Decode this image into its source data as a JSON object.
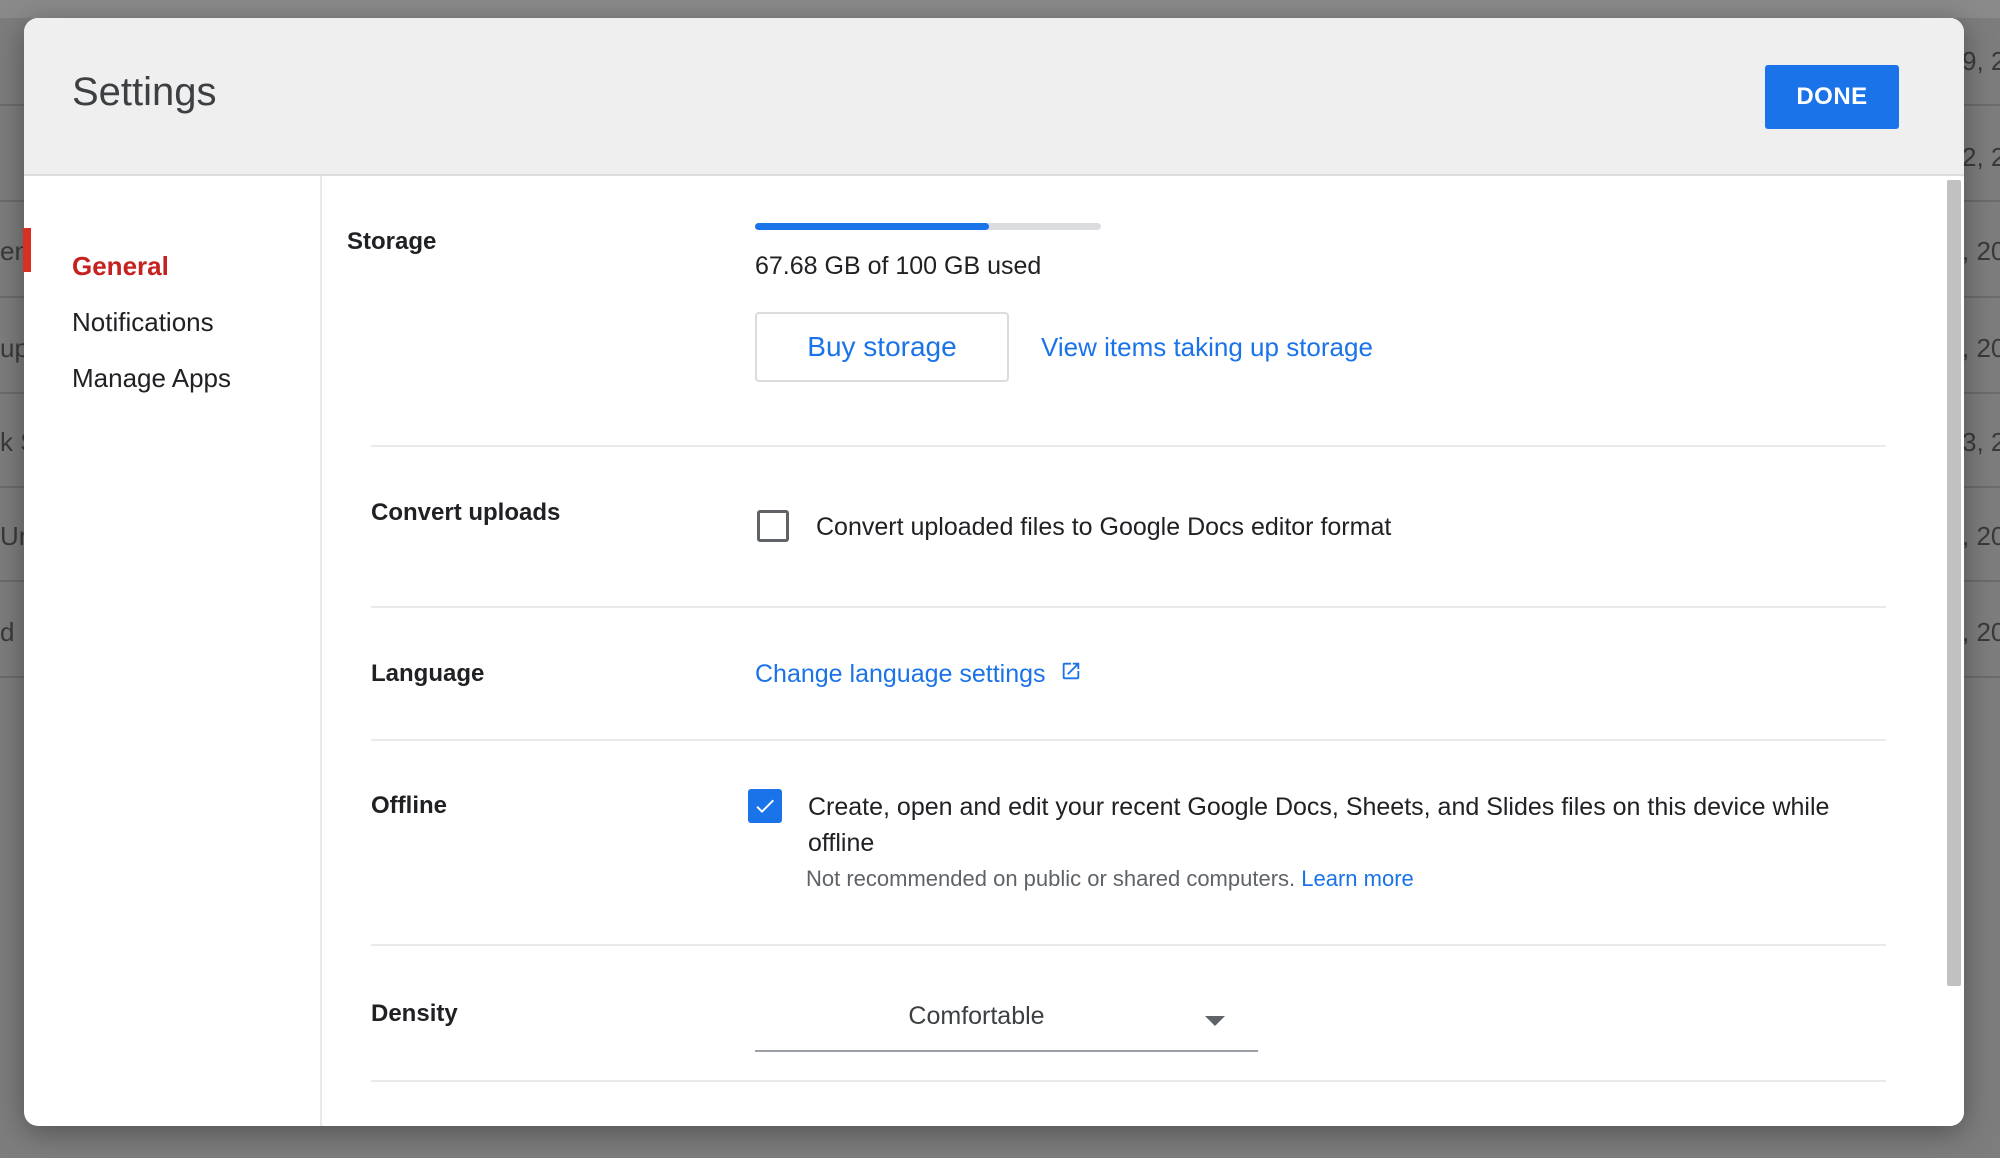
{
  "background": {
    "left_fragments": [
      "en",
      "up",
      "k S",
      "Uns",
      "d"
    ],
    "right_fragments": [
      "9, 2",
      "2, 2",
      ", 20",
      ", 20",
      "3, 2",
      ", 20",
      ", 20"
    ]
  },
  "dialog": {
    "title": "Settings",
    "done_label": "DONE"
  },
  "sidebar": {
    "items": [
      {
        "label": "General",
        "active": true
      },
      {
        "label": "Notifications",
        "active": false
      },
      {
        "label": "Manage Apps",
        "active": false
      }
    ]
  },
  "storage": {
    "label": "Storage",
    "used_fraction": 0.6768,
    "usage_text": "67.68 GB of 100 GB used",
    "buy_label": "Buy storage",
    "view_link": "View items taking up storage"
  },
  "convert_uploads": {
    "label": "Convert uploads",
    "checked": false,
    "option_text": "Convert uploaded files to Google Docs editor format"
  },
  "language": {
    "label": "Language",
    "link_text": "Change language settings",
    "icon": "open-in-new-icon"
  },
  "offline": {
    "label": "Offline",
    "checked": true,
    "option_text": "Create, open and edit your recent Google Docs, Sheets, and Slides files on this device while offline",
    "note_text": "Not recommended on public or shared computers.",
    "learn_more": "Learn more"
  },
  "density": {
    "label": "Density",
    "selected": "Comfortable"
  },
  "colors": {
    "accent": "#1a73e8",
    "active_nav": "#c5221f"
  }
}
